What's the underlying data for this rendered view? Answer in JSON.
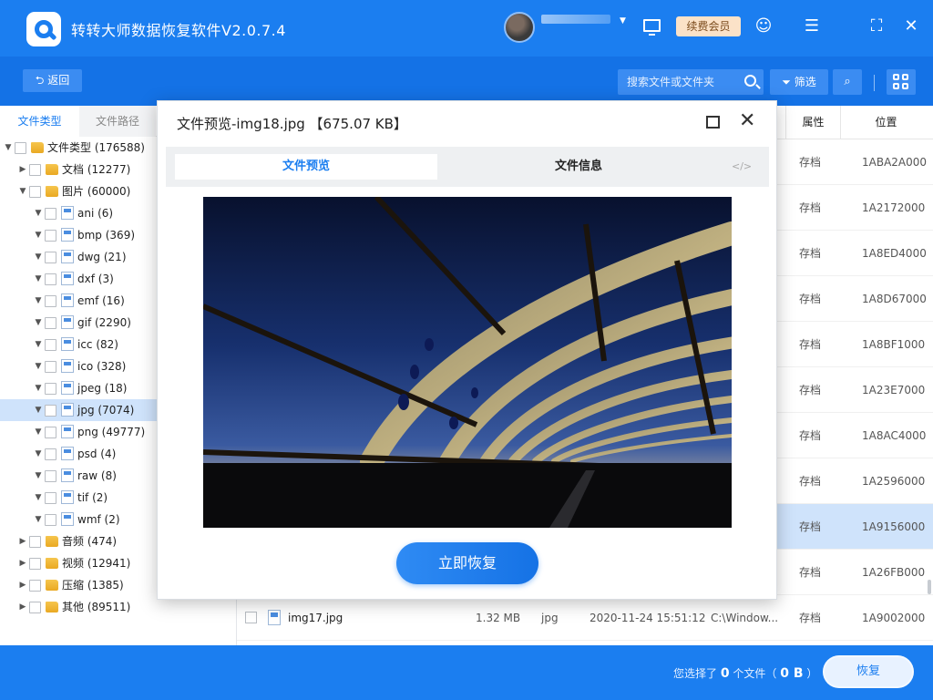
{
  "app": {
    "title": "转转大师数据恢复软件V2.0.7.4",
    "vip_label": "续费会员"
  },
  "toolbar": {
    "back_label": "返回",
    "search_placeholder": "搜索文件或文件夹",
    "filter_label": "筛选"
  },
  "left_panel": {
    "tab_file_type": "文件类型",
    "tab_file_path": "文件路径",
    "tree": [
      {
        "label": "文件类型 (176588)",
        "level": 0,
        "kind": "folder",
        "arrow": "expanded"
      },
      {
        "label": "文档 (12277)",
        "level": 1,
        "kind": "folder",
        "arrow": "collapsed"
      },
      {
        "label": "图片 (60000)",
        "level": 1,
        "kind": "folder",
        "arrow": "expanded"
      },
      {
        "label": "ani (6)",
        "level": 2,
        "kind": "file"
      },
      {
        "label": "bmp (369)",
        "level": 2,
        "kind": "file"
      },
      {
        "label": "dwg (21)",
        "level": 2,
        "kind": "file"
      },
      {
        "label": "dxf (3)",
        "level": 2,
        "kind": "file"
      },
      {
        "label": "emf (16)",
        "level": 2,
        "kind": "file"
      },
      {
        "label": "gif (2290)",
        "level": 2,
        "kind": "file"
      },
      {
        "label": "icc (82)",
        "level": 2,
        "kind": "file"
      },
      {
        "label": "ico (328)",
        "level": 2,
        "kind": "file"
      },
      {
        "label": "jpeg (18)",
        "level": 2,
        "kind": "file"
      },
      {
        "label": "jpg (7074)",
        "level": 2,
        "kind": "file",
        "selected": true
      },
      {
        "label": "png (49777)",
        "level": 2,
        "kind": "file"
      },
      {
        "label": "psd (4)",
        "level": 2,
        "kind": "file"
      },
      {
        "label": "raw (8)",
        "level": 2,
        "kind": "file"
      },
      {
        "label": "tif (2)",
        "level": 2,
        "kind": "file"
      },
      {
        "label": "wmf (2)",
        "level": 2,
        "kind": "file"
      },
      {
        "label": "音频 (474)",
        "level": 1,
        "kind": "folder",
        "arrow": "collapsed"
      },
      {
        "label": "视频 (12941)",
        "level": 1,
        "kind": "folder",
        "arrow": "collapsed"
      },
      {
        "label": "压缩 (1385)",
        "level": 1,
        "kind": "folder",
        "arrow": "collapsed"
      },
      {
        "label": "其他 (89511)",
        "level": 1,
        "kind": "folder",
        "arrow": "collapsed"
      }
    ]
  },
  "list": {
    "columns": {
      "attr": "属性",
      "location": "位置"
    },
    "rows": [
      {
        "attr": "存档",
        "location": "1ABA2A000"
      },
      {
        "attr": "存档",
        "location": "1A2172000"
      },
      {
        "attr": "存档",
        "location": "1A8ED4000"
      },
      {
        "attr": "存档",
        "location": "1A8D67000"
      },
      {
        "attr": "存档",
        "location": "1A8BF1000"
      },
      {
        "attr": "存档",
        "location": "1A23E7000"
      },
      {
        "attr": "存档",
        "location": "1A8AC4000"
      },
      {
        "attr": "存档",
        "location": "1A2596000"
      },
      {
        "attr": "存档",
        "location": "1A9156000",
        "selected": true
      },
      {
        "attr": "存档",
        "location": "1A26FB000"
      },
      {
        "name": "img17.jpg",
        "size": "1.32 MB",
        "type": "jpg",
        "time": "2020-11-24 15:51:12",
        "path": "C:\\Window...",
        "attr": "存档",
        "location": "1A9002000"
      }
    ]
  },
  "modal": {
    "title": "文件预览-img18.jpg 【675.07 KB】",
    "tab_preview": "文件预览",
    "tab_info": "文件信息",
    "tab_code": "</>",
    "recover_now": "立即恢复"
  },
  "bottom": {
    "status_prefix": "您选择了",
    "selected_count": "0",
    "status_mid": "个文件（",
    "selected_size": "0 B",
    "status_suffix": "）",
    "recover_label": "恢复"
  },
  "colors": {
    "brand_blue": "#1b7ef0",
    "toolbar_blue": "#1472e6",
    "selected_row": "#cfe3fb"
  }
}
